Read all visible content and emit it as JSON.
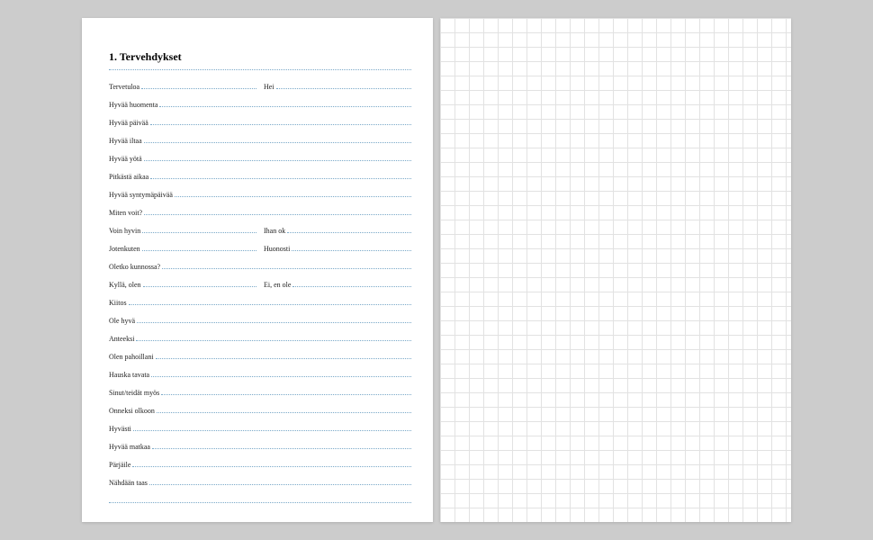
{
  "title": "1. Tervehdykset",
  "rows": [
    {
      "type": "split",
      "left": "Tervetuloa",
      "right": "Hei"
    },
    {
      "type": "single",
      "text": "Hyvää huomenta"
    },
    {
      "type": "single",
      "text": "Hyvää päivää"
    },
    {
      "type": "single",
      "text": "Hyvää iltaa"
    },
    {
      "type": "single",
      "text": "Hyvää yötä"
    },
    {
      "type": "single",
      "text": "Pitkästä aikaa"
    },
    {
      "type": "single",
      "text": "Hyvää syntymäpäivää"
    },
    {
      "type": "single",
      "text": "Miten voit?"
    },
    {
      "type": "split",
      "left": "Voin hyvin",
      "right": "Ihan ok"
    },
    {
      "type": "split",
      "left": "Jotenkuten",
      "right": "Huonosti"
    },
    {
      "type": "single",
      "text": "Oletko kunnossa?"
    },
    {
      "type": "split",
      "left": "Kyllä, olen",
      "right": "Ei, en ole"
    },
    {
      "type": "single",
      "text": "Kiitos"
    },
    {
      "type": "single",
      "text": "Ole hyvä"
    },
    {
      "type": "single",
      "text": "Anteeksi"
    },
    {
      "type": "single",
      "text": "Olen pahoillani"
    },
    {
      "type": "single",
      "text": "Hauska tavata"
    },
    {
      "type": "single",
      "text": "Sinut/teidät myös"
    },
    {
      "type": "single",
      "text": "Onneksi olkoon"
    },
    {
      "type": "single",
      "text": "Hyvästi"
    },
    {
      "type": "single",
      "text": "Hyvää matkaa"
    },
    {
      "type": "single",
      "text": "Pärjäile"
    },
    {
      "type": "single",
      "text": "Nähdään taas"
    },
    {
      "type": "blank"
    }
  ]
}
